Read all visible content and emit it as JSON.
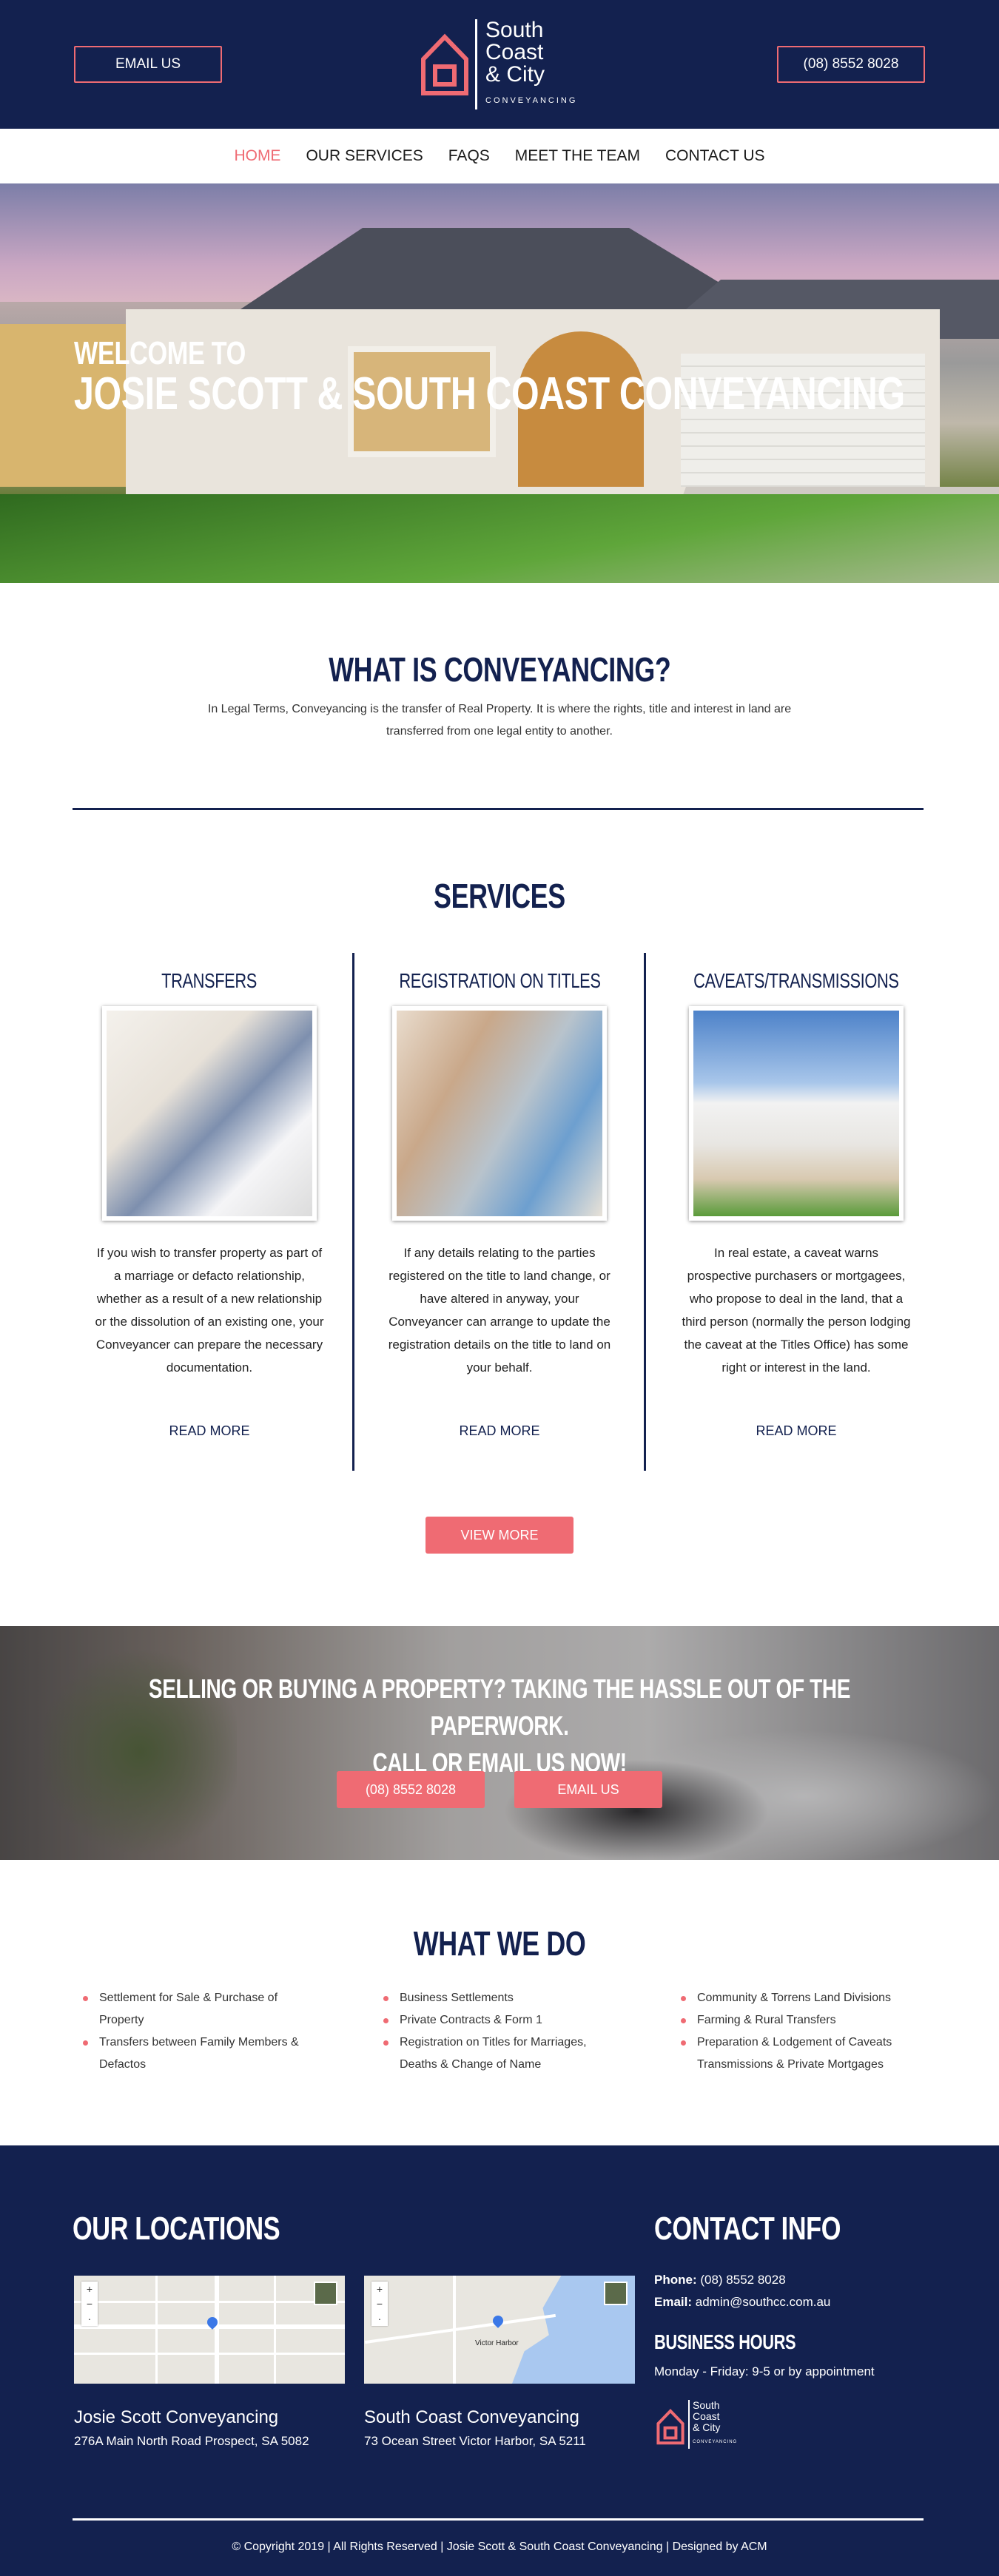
{
  "header": {
    "email_button": "EMAIL US",
    "phone_button": "(08) 8552 8028",
    "logo_lines": [
      "South",
      "Coast",
      "& City"
    ],
    "logo_tagline": "CONVEYANCING"
  },
  "nav": {
    "items": [
      "HOME",
      "OUR SERVICES",
      "FAQS",
      "MEET THE TEAM",
      "CONTACT US"
    ],
    "active": "HOME"
  },
  "hero": {
    "line1": "WELCOME TO",
    "line2": "JOSIE SCOTT & SOUTH COAST CONVEYANCING"
  },
  "conveyancing": {
    "title": "WHAT IS CONVEYANCING?",
    "body": "In Legal Terms, Conveyancing is the transfer of Real Property. It is where the rights, title and interest in land are transferred from one legal entity to another."
  },
  "services": {
    "title": "SERVICES",
    "items": [
      {
        "title": "TRANSFERS",
        "text": "If you wish to transfer property as part of a marriage or defacto relationship, whether as a result of a new relationship or the dissolution of an existing one, your Conveyancer can prepare the necessary documentation.",
        "link": "READ MORE"
      },
      {
        "title": "REGISTRATION ON TITLES",
        "text": "If any details relating to the parties registered on the title to land change, or have altered in anyway, your Conveyancer can arrange to update the registration details on the title to land on your behalf.",
        "link": "READ MORE"
      },
      {
        "title": "CAVEATS/TRANSMISSIONS",
        "text": "In real estate, a caveat warns prospective purchasers or mortgagees, who propose to deal in the land, that a third person (normally the person lodging the caveat at the Titles Office) has some right or interest in the land.",
        "link": "READ MORE"
      }
    ],
    "view_more": "VIEW MORE"
  },
  "cta": {
    "line1": "SELLING OR BUYING A PROPERTY? TAKING THE HASSLE OUT OF THE PAPERWORK.",
    "line2": "CALL OR EMAIL US NOW!",
    "phone_button": "(08) 8552 8028",
    "email_button": "EMAIL US"
  },
  "what_we_do": {
    "title": "WHAT WE DO",
    "columns": [
      [
        "Settlement for Sale & Purchase of Property",
        "Transfers between Family Members & Defactos"
      ],
      [
        "Business Settlements",
        "Private Contracts & Form 1",
        "Registration on Titles for Marriages, Deaths & Change of Name"
      ],
      [
        "Community & Torrens Land Divisions",
        "Farming & Rural Transfers",
        "Preparation & Lodgement of Caveats Transmissions & Private Mortgages"
      ]
    ]
  },
  "footer": {
    "locations_title": "OUR LOCATIONS",
    "locations": [
      {
        "name": "Josie Scott Conveyancing",
        "address": "276A Main North Road Prospect, SA 5082"
      },
      {
        "name": "South Coast Conveyancing",
        "address": "73 Ocean Street Victor Harbor, SA 5211",
        "map_label": "Victor Harbor"
      }
    ],
    "contact_title": "CONTACT INFO",
    "phone_label": "Phone:",
    "phone": "(08) 8552 8028",
    "email_label": "Email:",
    "email": "admin@southcc.com.au",
    "hours_title": "BUSINESS HOURS",
    "hours": "Monday - Friday: 9-5 or by appointment",
    "copyright": "© Copyright 2019 | All Rights Reserved | Josie Scott & South Coast Conveyancing | Designed by ACM"
  },
  "colors": {
    "navy": "#13214f",
    "accent": "#ef6b73"
  }
}
